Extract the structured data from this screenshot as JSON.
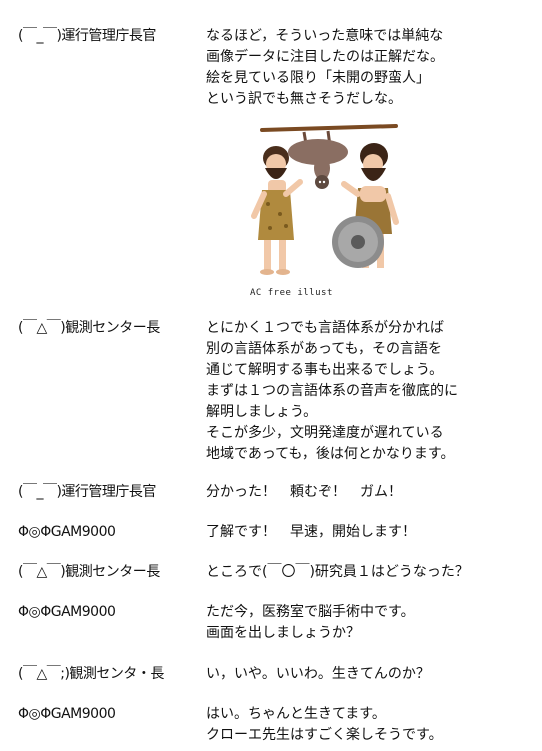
{
  "dialogue": [
    {
      "speaker": "(￣_￣)運行管理庁長官",
      "lines": [
        "なるほど，そういった意味では単純な",
        "画像データに注目したのは正解だな。",
        "絵を見ている限り「未開の野蛮人」",
        "という訳でも無さそうだしな。"
      ]
    },
    {
      "speaker": "(￣△￣)観測センター長",
      "lines": [
        "とにかく１つでも言語体系が分かれば",
        "別の言語体系があっても，その言語を",
        "通じて解明する事も出来るでしょう。",
        "まずは１つの言語体系の音声を徹底的に",
        "解明しましょう。",
        "そこが多少，文明発達度が遅れている",
        "地域であっても，後は何とかなります。"
      ]
    },
    {
      "speaker": "(￣_￣)運行管理庁長官",
      "lines": [
        "分かった！　頼むぞ！　ガム！"
      ]
    },
    {
      "speaker": "Φ◎ΦGAM9000",
      "lines": [
        "了解です！　早速，開始します！"
      ]
    },
    {
      "speaker": "(￣△￣)観測センター長",
      "lines": [
        "ところで(￣〇￣)研究員１はどうなった？"
      ]
    },
    {
      "speaker": "Φ◎ΦGAM9000",
      "lines": [
        "ただ今，医務室で脳手術中です。",
        "画面を出しましょうか？"
      ]
    },
    {
      "speaker": "(￣△￣;)観測センタ・長",
      "lines": [
        "い，いや。いいわ。生きてんのか？"
      ]
    },
    {
      "speaker": "Φ◎ΦGAM9000",
      "lines": [
        "はい。ちゃんと生きてます。",
        "クローエ先生はすごく楽しそうです。"
      ]
    }
  ],
  "illustration": {
    "credit": "AC free illust"
  }
}
